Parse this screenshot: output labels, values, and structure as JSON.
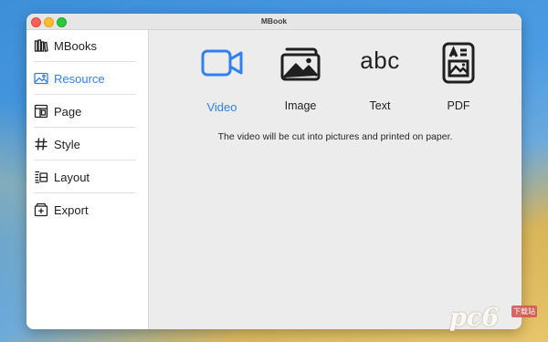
{
  "window": {
    "title": "MBook"
  },
  "sidebar": {
    "items": [
      {
        "label": "MBooks",
        "icon": "books-icon",
        "active": false
      },
      {
        "label": "Resource",
        "icon": "image-icon",
        "active": true
      },
      {
        "label": "Page",
        "icon": "page-icon",
        "active": false
      },
      {
        "label": "Style",
        "icon": "hashtag-icon",
        "active": false
      },
      {
        "label": "Layout",
        "icon": "layout-icon",
        "active": false
      },
      {
        "label": "Export",
        "icon": "export-icon",
        "active": false
      }
    ]
  },
  "resources": {
    "items": [
      {
        "label": "Video",
        "icon": "video-camera-icon",
        "active": true
      },
      {
        "label": "Image",
        "icon": "photos-icon",
        "active": false
      },
      {
        "label": "Text",
        "icon": "abc-text-icon",
        "glyph": "abc",
        "active": false
      },
      {
        "label": "PDF",
        "icon": "pdf-document-icon",
        "active": false
      }
    ],
    "hint": "The video will be cut into pictures and printed on paper."
  },
  "colors": {
    "accent": "#2f7ff5",
    "sidebar_bg": "#ffffff",
    "content_bg": "#ececec"
  },
  "watermark": {
    "text": "pc6",
    "small": "下载站"
  }
}
